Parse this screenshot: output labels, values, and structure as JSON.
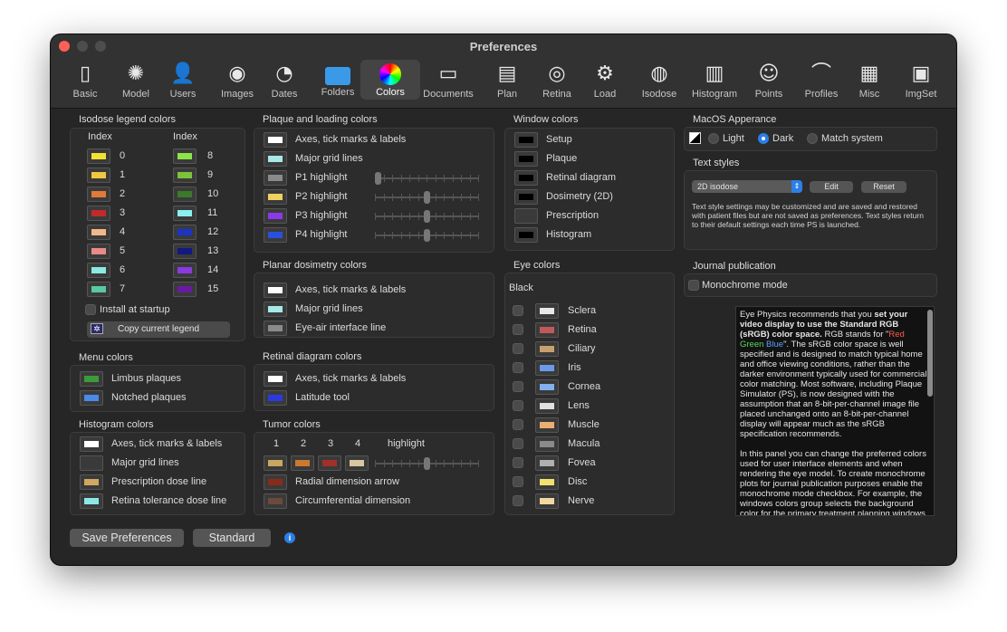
{
  "window": {
    "title": "Preferences"
  },
  "toolbar": [
    {
      "label": "Basic",
      "icon": "switch-icon"
    },
    {
      "label": "Model",
      "icon": "model-icon"
    },
    {
      "label": "Users",
      "icon": "users-icon"
    },
    {
      "label": "Images",
      "icon": "images-icon"
    },
    {
      "label": "Dates",
      "icon": "dates-icon"
    },
    {
      "label": "Folders",
      "icon": "folder-icon"
    },
    {
      "label": "Colors",
      "icon": "colors-icon",
      "selected": true
    },
    {
      "label": "Documents",
      "icon": "documents-icon"
    },
    {
      "label": "Plan",
      "icon": "plan-icon"
    },
    {
      "label": "Retina",
      "icon": "retina-icon"
    },
    {
      "label": "Load",
      "icon": "load-icon"
    },
    {
      "label": "Isodose",
      "icon": "isodose-icon"
    },
    {
      "label": "Histogram",
      "icon": "histogram-icon"
    },
    {
      "label": "Points",
      "icon": "points-icon"
    },
    {
      "label": "Profiles",
      "icon": "profiles-icon"
    },
    {
      "label": "Misc",
      "icon": "misc-icon"
    },
    {
      "label": "ImgSet",
      "icon": "imgset-icon"
    }
  ],
  "isodose": {
    "title": "Isodose legend colors",
    "index_label": "Index",
    "left": [
      {
        "n": "0",
        "color": "#f2e233"
      },
      {
        "n": "1",
        "color": "#f0c840"
      },
      {
        "n": "2",
        "color": "#e07a3a"
      },
      {
        "n": "3",
        "color": "#c02a2a"
      },
      {
        "n": "4",
        "color": "#f0b78a"
      },
      {
        "n": "5",
        "color": "#e88a8a"
      },
      {
        "n": "6",
        "color": "#8ce8e0"
      },
      {
        "n": "7",
        "color": "#5ac8a0"
      }
    ],
    "right": [
      {
        "n": "8",
        "color": "#8ce44a"
      },
      {
        "n": "9",
        "color": "#7cc33a"
      },
      {
        "n": "10",
        "color": "#3a7a2a"
      },
      {
        "n": "11",
        "color": "#8cf0f0"
      },
      {
        "n": "12",
        "color": "#1a34c8"
      },
      {
        "n": "13",
        "color": "#101a80"
      },
      {
        "n": "14",
        "color": "#8a3ae0"
      },
      {
        "n": "15",
        "color": "#6a1aa0"
      }
    ],
    "install_label": "Install at startup",
    "copy_label": "Copy current legend"
  },
  "menu": {
    "title": "Menu colors",
    "items": [
      {
        "label": "Limbus plaques",
        "color": "#3c9a3a"
      },
      {
        "label": "Notched plaques",
        "color": "#4a8ae8"
      }
    ]
  },
  "histogram": {
    "title": "Histogram colors",
    "items": [
      {
        "label": "Axes, tick marks & labels",
        "color": "#ffffff"
      },
      {
        "label": "Major grid lines",
        "color": "#3a3a3a"
      },
      {
        "label": "Prescription dose line",
        "color": "#d0a860"
      },
      {
        "label": "Retina tolerance dose line",
        "color": "#8ce8e8"
      }
    ]
  },
  "plaque": {
    "title": "Plaque and loading colors",
    "items": [
      {
        "label": "Axes, tick marks & labels",
        "color": "#ffffff"
      },
      {
        "label": "Major grid lines",
        "color": "#a8e8e8"
      },
      {
        "label": "P1 highlight",
        "color": "#8a8a8a",
        "level": 0.0
      },
      {
        "label": "P2 highlight",
        "color": "#f0d060",
        "level": 0.5
      },
      {
        "label": "P3 highlight",
        "color": "#8a3ae8",
        "level": 0.5
      },
      {
        "label": "P4 highlight",
        "color": "#2a50e0",
        "level": 0.5
      }
    ]
  },
  "planar": {
    "title": "Planar dosimetry colors",
    "items": [
      {
        "label": "Axes, tick marks & labels",
        "color": "#ffffff"
      },
      {
        "label": "Major grid lines",
        "color": "#a8e8e8"
      },
      {
        "label": "Eye-air interface line",
        "color": "#8a8a8a"
      }
    ]
  },
  "retinal": {
    "title": "Retinal diagram colors",
    "items": [
      {
        "label": "Axes, tick marks & labels",
        "color": "#ffffff"
      },
      {
        "label": "Latitude tool",
        "color": "#2a3ae0"
      }
    ]
  },
  "tumor": {
    "title": "Tumor colors",
    "nums": [
      "1",
      "2",
      "3",
      "4"
    ],
    "highlight_label": "highlight",
    "highlight_level": 0.5,
    "swatches": [
      "#c8a860",
      "#c87a30",
      "#a03028",
      "#d8c8a0"
    ],
    "items": [
      {
        "label": "Radial dimension arrow",
        "color": "#8a2a1a"
      },
      {
        "label": "Circumferential dimension",
        "color": "#6a4a3a"
      }
    ]
  },
  "window_colors": {
    "title": "Window colors",
    "items": [
      {
        "label": "Setup",
        "color": "#000000"
      },
      {
        "label": "Plaque",
        "color": "#000000"
      },
      {
        "label": "Retinal diagram",
        "color": "#000000"
      },
      {
        "label": "Dosimetry (2D)",
        "color": "#000000"
      },
      {
        "label": "Prescription",
        "color": "#3a3a3a"
      },
      {
        "label": "Histogram",
        "color": "#000000"
      }
    ]
  },
  "eye": {
    "title": "Eye colors",
    "black_label": "Black",
    "items": [
      {
        "label": "Sclera",
        "color": "#e8e8e8"
      },
      {
        "label": "Retina",
        "color": "#c05a5a"
      },
      {
        "label": "Ciliary",
        "color": "#c8a070"
      },
      {
        "label": "Iris",
        "color": "#6a9ae8"
      },
      {
        "label": "Cornea",
        "color": "#80b0f0"
      },
      {
        "label": "Lens",
        "color": "#e0e0e0"
      },
      {
        "label": "Muscle",
        "color": "#e8b070"
      },
      {
        "label": "Macula",
        "color": "#8a8a8a"
      },
      {
        "label": "Fovea",
        "color": "#b0b0b0"
      },
      {
        "label": "Disc",
        "color": "#f0e070"
      },
      {
        "label": "Nerve",
        "color": "#f0d8a0"
      }
    ]
  },
  "macos": {
    "title": "MacOS Apperance",
    "options": [
      {
        "label": "Light",
        "selected": false
      },
      {
        "label": "Dark",
        "selected": true
      },
      {
        "label": "Match system",
        "selected": false
      }
    ]
  },
  "text_styles": {
    "title": "Text styles",
    "popup_value": "2D isodose",
    "edit_label": "Edit",
    "reset_label": "Reset",
    "note": "Text style settings may be customized and are saved and restored with patient files but are not saved as preferences. Text styles return to their default settings each time PS is launched."
  },
  "journal": {
    "title": "Journal publication",
    "mono_label": "Monochrome mode"
  },
  "info": {
    "p1_a": "Eye Physics recommends that you ",
    "p1_bold": "set your video display to use the Standard RGB (sRGB) color space.",
    "p1_b": " RGB stands for \"",
    "red": "Red",
    "green": "Green",
    "blue": "Blue",
    "p1_c": "\". The sRGB color space is well specified and is designed to match typical home and office viewing conditions, rather than the darker environment typically used for commercial color matching. Most software, including Plaque Simulator (PS), is now designed with the assumption that an 8-bit-per-channel image file placed unchanged onto an 8-bit-per-channel display will appear much as the sRGB specification recommends.",
    "p2": "In this panel you can change the preferred colors used for user interface elements and when rendering the eye model. To create monochrome plots for journal publication purposes enable the monochrome mode checkbox. For example, the windows colors group selects the background color for the primary treatment planning windows. White is the recommended color for most situations when running in MacOS light appearance mode and black when in MacOS dark appearance mode. Most"
  },
  "footer": {
    "save_label": "Save Preferences",
    "standard_label": "Standard"
  },
  "colors": {
    "accent": "#2b7fe6",
    "close": "#fe5f57"
  }
}
